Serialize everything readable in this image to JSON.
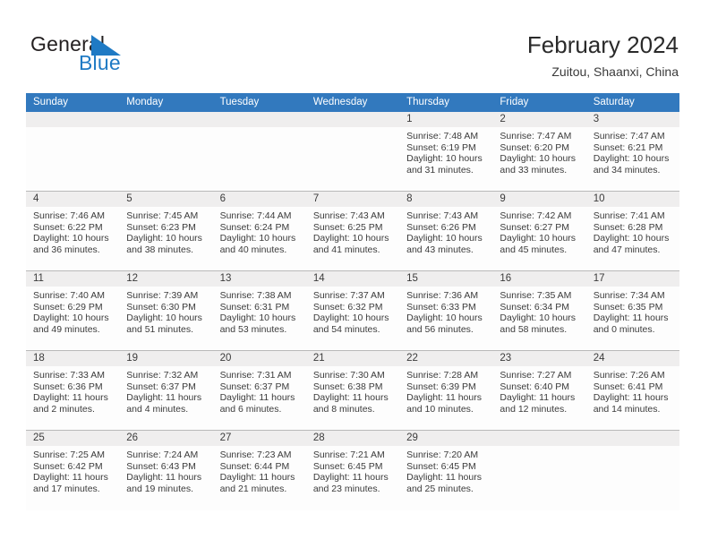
{
  "brand": {
    "name_top": "General",
    "name_bottom": "Blue",
    "triangle_icon": "triangle-logo-icon",
    "color_top": "#231f20",
    "color_bottom": "#1f7ac4"
  },
  "header": {
    "title": "February 2024",
    "subtitle": "Zuitou, Shaanxi, China"
  },
  "theme": {
    "header_blue": "#3279be",
    "datestrip_gray": "#efeeee",
    "row_border": "#b9b9b9",
    "text": "#3b3b3b"
  },
  "weekdays": [
    "Sunday",
    "Monday",
    "Tuesday",
    "Wednesday",
    "Thursday",
    "Friday",
    "Saturday"
  ],
  "weeks": [
    [
      {
        "day": "",
        "lines": []
      },
      {
        "day": "",
        "lines": []
      },
      {
        "day": "",
        "lines": []
      },
      {
        "day": "",
        "lines": []
      },
      {
        "day": "1",
        "lines": [
          "Sunrise: 7:48 AM",
          "Sunset: 6:19 PM",
          "Daylight: 10 hours",
          "and 31 minutes."
        ]
      },
      {
        "day": "2",
        "lines": [
          "Sunrise: 7:47 AM",
          "Sunset: 6:20 PM",
          "Daylight: 10 hours",
          "and 33 minutes."
        ]
      },
      {
        "day": "3",
        "lines": [
          "Sunrise: 7:47 AM",
          "Sunset: 6:21 PM",
          "Daylight: 10 hours",
          "and 34 minutes."
        ]
      }
    ],
    [
      {
        "day": "4",
        "lines": [
          "Sunrise: 7:46 AM",
          "Sunset: 6:22 PM",
          "Daylight: 10 hours",
          "and 36 minutes."
        ]
      },
      {
        "day": "5",
        "lines": [
          "Sunrise: 7:45 AM",
          "Sunset: 6:23 PM",
          "Daylight: 10 hours",
          "and 38 minutes."
        ]
      },
      {
        "day": "6",
        "lines": [
          "Sunrise: 7:44 AM",
          "Sunset: 6:24 PM",
          "Daylight: 10 hours",
          "and 40 minutes."
        ]
      },
      {
        "day": "7",
        "lines": [
          "Sunrise: 7:43 AM",
          "Sunset: 6:25 PM",
          "Daylight: 10 hours",
          "and 41 minutes."
        ]
      },
      {
        "day": "8",
        "lines": [
          "Sunrise: 7:43 AM",
          "Sunset: 6:26 PM",
          "Daylight: 10 hours",
          "and 43 minutes."
        ]
      },
      {
        "day": "9",
        "lines": [
          "Sunrise: 7:42 AM",
          "Sunset: 6:27 PM",
          "Daylight: 10 hours",
          "and 45 minutes."
        ]
      },
      {
        "day": "10",
        "lines": [
          "Sunrise: 7:41 AM",
          "Sunset: 6:28 PM",
          "Daylight: 10 hours",
          "and 47 minutes."
        ]
      }
    ],
    [
      {
        "day": "11",
        "lines": [
          "Sunrise: 7:40 AM",
          "Sunset: 6:29 PM",
          "Daylight: 10 hours",
          "and 49 minutes."
        ]
      },
      {
        "day": "12",
        "lines": [
          "Sunrise: 7:39 AM",
          "Sunset: 6:30 PM",
          "Daylight: 10 hours",
          "and 51 minutes."
        ]
      },
      {
        "day": "13",
        "lines": [
          "Sunrise: 7:38 AM",
          "Sunset: 6:31 PM",
          "Daylight: 10 hours",
          "and 53 minutes."
        ]
      },
      {
        "day": "14",
        "lines": [
          "Sunrise: 7:37 AM",
          "Sunset: 6:32 PM",
          "Daylight: 10 hours",
          "and 54 minutes."
        ]
      },
      {
        "day": "15",
        "lines": [
          "Sunrise: 7:36 AM",
          "Sunset: 6:33 PM",
          "Daylight: 10 hours",
          "and 56 minutes."
        ]
      },
      {
        "day": "16",
        "lines": [
          "Sunrise: 7:35 AM",
          "Sunset: 6:34 PM",
          "Daylight: 10 hours",
          "and 58 minutes."
        ]
      },
      {
        "day": "17",
        "lines": [
          "Sunrise: 7:34 AM",
          "Sunset: 6:35 PM",
          "Daylight: 11 hours",
          "and 0 minutes."
        ]
      }
    ],
    [
      {
        "day": "18",
        "lines": [
          "Sunrise: 7:33 AM",
          "Sunset: 6:36 PM",
          "Daylight: 11 hours",
          "and 2 minutes."
        ]
      },
      {
        "day": "19",
        "lines": [
          "Sunrise: 7:32 AM",
          "Sunset: 6:37 PM",
          "Daylight: 11 hours",
          "and 4 minutes."
        ]
      },
      {
        "day": "20",
        "lines": [
          "Sunrise: 7:31 AM",
          "Sunset: 6:37 PM",
          "Daylight: 11 hours",
          "and 6 minutes."
        ]
      },
      {
        "day": "21",
        "lines": [
          "Sunrise: 7:30 AM",
          "Sunset: 6:38 PM",
          "Daylight: 11 hours",
          "and 8 minutes."
        ]
      },
      {
        "day": "22",
        "lines": [
          "Sunrise: 7:28 AM",
          "Sunset: 6:39 PM",
          "Daylight: 11 hours",
          "and 10 minutes."
        ]
      },
      {
        "day": "23",
        "lines": [
          "Sunrise: 7:27 AM",
          "Sunset: 6:40 PM",
          "Daylight: 11 hours",
          "and 12 minutes."
        ]
      },
      {
        "day": "24",
        "lines": [
          "Sunrise: 7:26 AM",
          "Sunset: 6:41 PM",
          "Daylight: 11 hours",
          "and 14 minutes."
        ]
      }
    ],
    [
      {
        "day": "25",
        "lines": [
          "Sunrise: 7:25 AM",
          "Sunset: 6:42 PM",
          "Daylight: 11 hours",
          "and 17 minutes."
        ]
      },
      {
        "day": "26",
        "lines": [
          "Sunrise: 7:24 AM",
          "Sunset: 6:43 PM",
          "Daylight: 11 hours",
          "and 19 minutes."
        ]
      },
      {
        "day": "27",
        "lines": [
          "Sunrise: 7:23 AM",
          "Sunset: 6:44 PM",
          "Daylight: 11 hours",
          "and 21 minutes."
        ]
      },
      {
        "day": "28",
        "lines": [
          "Sunrise: 7:21 AM",
          "Sunset: 6:45 PM",
          "Daylight: 11 hours",
          "and 23 minutes."
        ]
      },
      {
        "day": "29",
        "lines": [
          "Sunrise: 7:20 AM",
          "Sunset: 6:45 PM",
          "Daylight: 11 hours",
          "and 25 minutes."
        ]
      },
      {
        "day": "",
        "lines": []
      },
      {
        "day": "",
        "lines": []
      }
    ]
  ]
}
